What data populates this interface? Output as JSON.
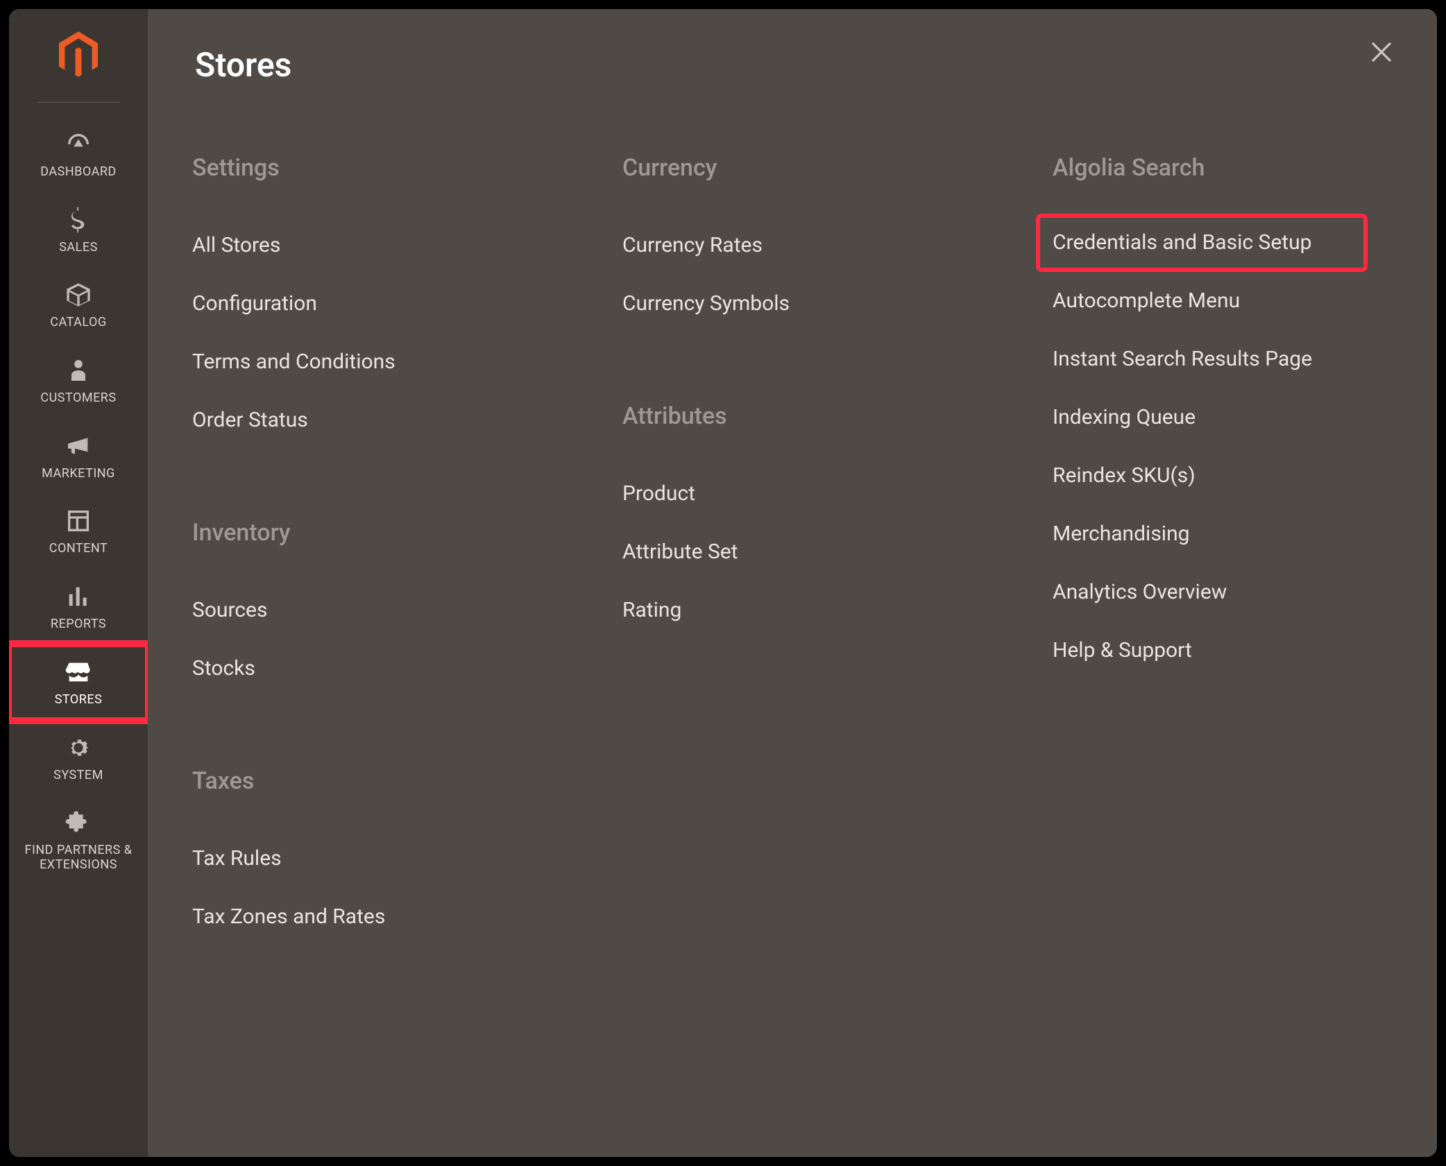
{
  "sidebar": {
    "items": [
      {
        "key": "dashboard",
        "label": "DASHBOARD"
      },
      {
        "key": "sales",
        "label": "SALES"
      },
      {
        "key": "catalog",
        "label": "CATALOG"
      },
      {
        "key": "customers",
        "label": "CUSTOMERS"
      },
      {
        "key": "marketing",
        "label": "MARKETING"
      },
      {
        "key": "content",
        "label": "CONTENT"
      },
      {
        "key": "reports",
        "label": "REPORTS"
      },
      {
        "key": "stores",
        "label": "STORES"
      },
      {
        "key": "system",
        "label": "SYSTEM"
      },
      {
        "key": "partners",
        "label": "FIND PARTNERS & EXTENSIONS"
      }
    ]
  },
  "panel": {
    "title": "Stores",
    "columns": [
      {
        "groups": [
          {
            "key": "settings",
            "title": "Settings",
            "items": [
              "All Stores",
              "Configuration",
              "Terms and Conditions",
              "Order Status"
            ]
          },
          {
            "key": "inventory",
            "title": "Inventory",
            "items": [
              "Sources",
              "Stocks"
            ]
          },
          {
            "key": "taxes",
            "title": "Taxes",
            "items": [
              "Tax Rules",
              "Tax Zones and Rates"
            ]
          }
        ]
      },
      {
        "groups": [
          {
            "key": "currency",
            "title": "Currency",
            "items": [
              "Currency Rates",
              "Currency Symbols"
            ]
          },
          {
            "key": "attributes",
            "title": "Attributes",
            "items": [
              "Product",
              "Attribute Set",
              "Rating"
            ]
          }
        ]
      },
      {
        "groups": [
          {
            "key": "algolia",
            "title": "Algolia Search",
            "items": [
              "Credentials and Basic Setup",
              "Autocomplete Menu",
              "Instant Search Results Page",
              "Indexing Queue",
              "Reindex SKU(s)",
              "Merchandising",
              "Analytics Overview",
              "Help & Support"
            ],
            "highlight_index": 0
          }
        ]
      }
    ]
  },
  "accent": "#ff2a3f",
  "brand": "#ef5b25"
}
